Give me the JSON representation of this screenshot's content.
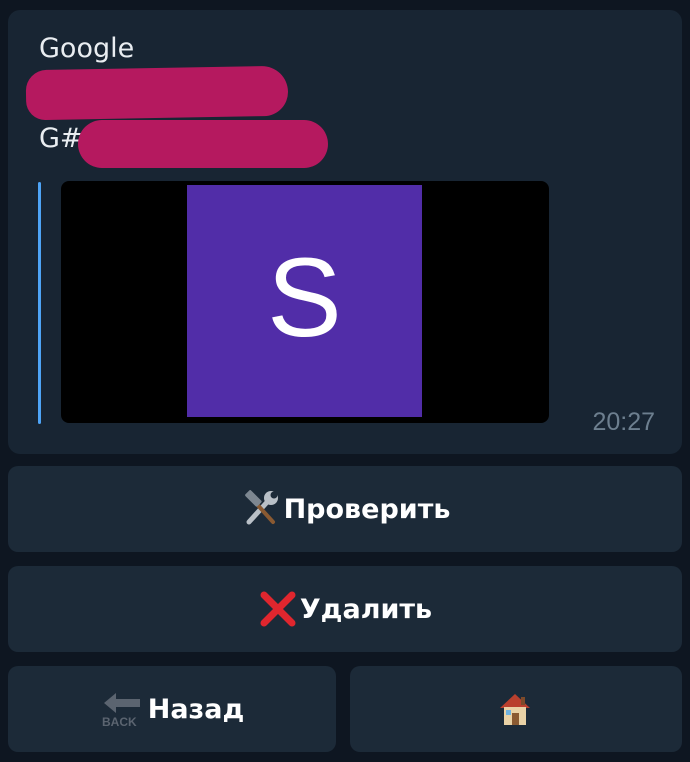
{
  "message": {
    "sender": "Google",
    "line2_prefix": "G#",
    "preview_letter": "S",
    "time": "20:27"
  },
  "keyboard": {
    "check_label": "Проверить",
    "delete_label": "Удалить",
    "back_label": "Назад",
    "back_icon_text": "BACK",
    "icons": {
      "check": "hammer-and-wrench-icon",
      "delete": "cross-mark-icon",
      "back": "back-arrow-icon",
      "home": "house-icon"
    }
  },
  "colors": {
    "background": "#0e1621",
    "bubble": "#182533",
    "button": "#1c2a38",
    "redaction": "#b5195f",
    "quote_bar": "#4ea4f6",
    "preview_tile": "#512da8",
    "time": "#6d7f8f"
  }
}
